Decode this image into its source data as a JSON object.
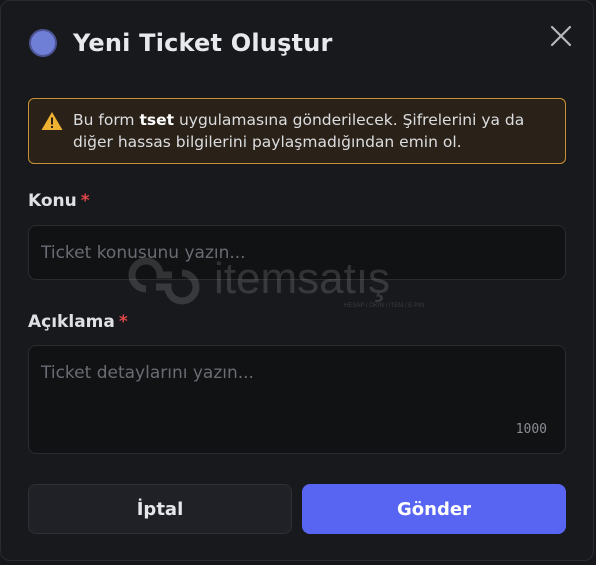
{
  "modal": {
    "title": "Yeni Ticket Oluştur",
    "notice": {
      "text_before": "Bu form ",
      "app_name": "tset",
      "text_after": " uygulamasına gönderilecek. Şifrelerini ya da diğer hassas bilgilerini paylaşmadığından emin ol."
    },
    "subject": {
      "label": "Konu",
      "required_mark": "*",
      "placeholder": "Ticket konusunu yazın...",
      "value": ""
    },
    "description": {
      "label": "Açıklama",
      "required_mark": "*",
      "placeholder": "Ticket detaylarını yazın...",
      "value": "",
      "char_counter": "1000"
    },
    "buttons": {
      "cancel_label": "İptal",
      "submit_label": "Gönder"
    }
  },
  "watermark": {
    "text": "itemsatış",
    "tagline": "HESAP / OKIN / ITEM / E-PIN"
  },
  "colors": {
    "accent": "#5865f2",
    "warning_border": "#c78f33",
    "required": "#e04848",
    "avatar": "#6f7fd6"
  },
  "icons": {
    "avatar": "app-avatar",
    "close": "close-icon",
    "warning": "warning-icon"
  }
}
